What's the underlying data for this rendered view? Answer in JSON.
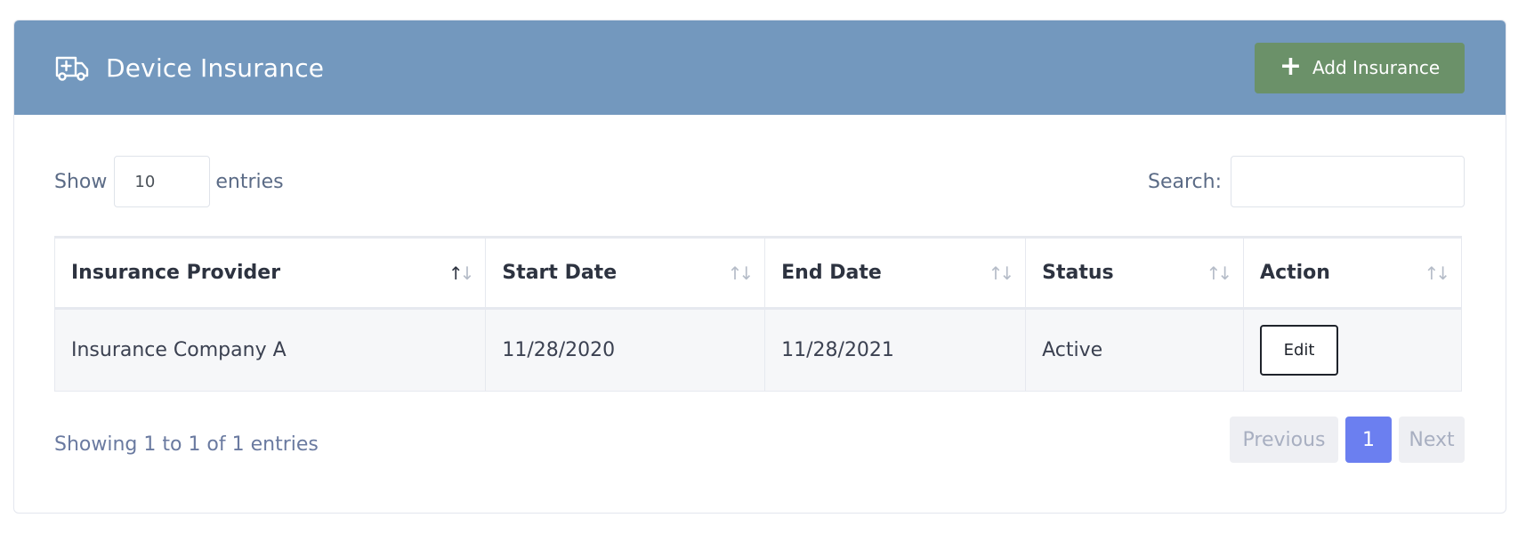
{
  "header": {
    "title": "Device Insurance",
    "icon": "ambulance-icon",
    "add_button_label": "Add Insurance",
    "background": "#7398be",
    "button_color": "#6b9169"
  },
  "controls": {
    "show_label": "Show",
    "page_length": "10",
    "entries_label": "entries",
    "search_label": "Search:",
    "search_value": ""
  },
  "table": {
    "columns": [
      "Insurance Provider",
      "Start Date",
      "End Date",
      "Status",
      "Action"
    ],
    "rows": [
      {
        "provider": "Insurance Company A",
        "start_date": "11/28/2020",
        "end_date": "11/28/2021",
        "status": "Active",
        "action_label": "Edit"
      }
    ]
  },
  "footer": {
    "info": "Showing 1 to 1 of 1 entries",
    "previous_label": "Previous",
    "current_page": "1",
    "next_label": "Next",
    "accent": "#6b7ff0"
  }
}
